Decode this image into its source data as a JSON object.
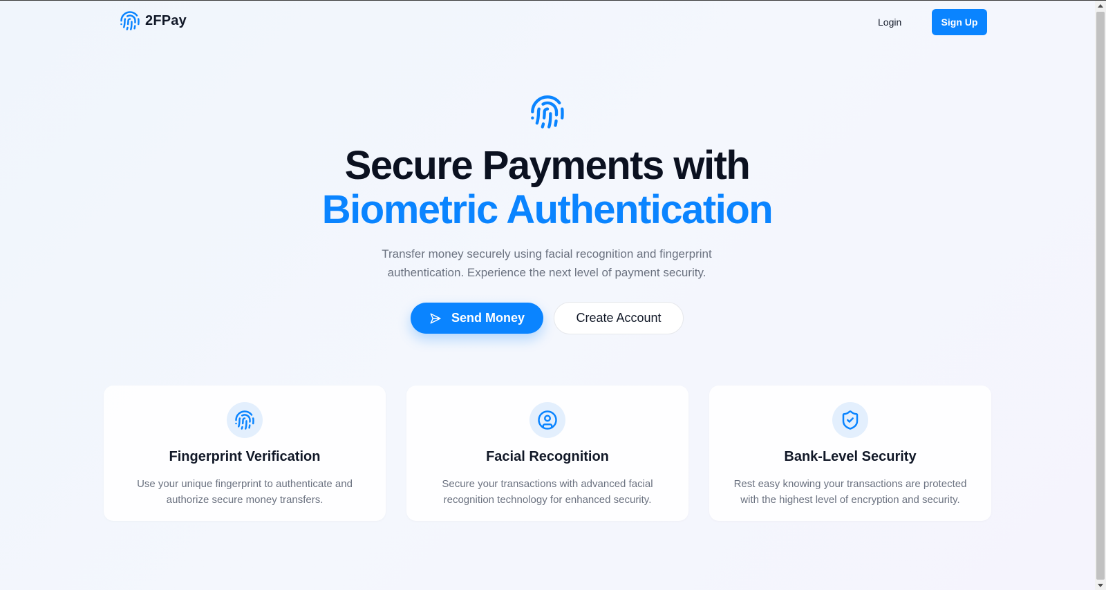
{
  "brand": {
    "name": "2FPay",
    "logo_icon": "fingerprint-icon",
    "accent": "#0a84ff"
  },
  "nav": {
    "login_label": "Login",
    "signup_label": "Sign Up"
  },
  "hero": {
    "icon": "fingerprint-icon",
    "title_line1": "Secure Payments with",
    "title_line2": "Biometric Authentication",
    "subtitle_line1": "Transfer money securely using facial recognition and fingerprint",
    "subtitle_line2": "authentication. Experience the next level of payment security.",
    "send_money_label": "Send Money",
    "send_money_icon": "send-icon",
    "create_account_label": "Create Account"
  },
  "features": [
    {
      "icon": "fingerprint-icon",
      "title": "Fingerprint Verification",
      "desc_line1": "Use your unique fingerprint to authenticate and",
      "desc_line2": "authorize secure money transfers."
    },
    {
      "icon": "user-circle-icon",
      "title": "Facial Recognition",
      "desc_line1": "Secure your transactions with advanced facial",
      "desc_line2": "recognition technology for enhanced security."
    },
    {
      "icon": "shield-check-icon",
      "title": "Bank-Level Security",
      "desc_line1": "Rest easy knowing your transactions are protected",
      "desc_line2": "with the highest level of encryption and security."
    }
  ]
}
